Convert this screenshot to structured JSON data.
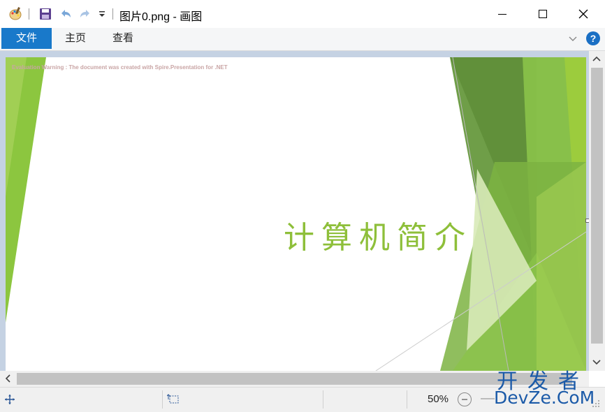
{
  "window": {
    "title": "图片0.png - 画图"
  },
  "quick_access": {
    "icons": [
      "paint-app-icon",
      "save-icon",
      "undo-icon",
      "redo-icon",
      "customize-dropdown-icon"
    ]
  },
  "window_controls": [
    "minimize-icon",
    "maximize-icon",
    "close-icon"
  ],
  "ribbon": {
    "tabs": [
      {
        "label": "文件",
        "active": true
      },
      {
        "label": "主页",
        "active": false
      },
      {
        "label": "查看",
        "active": false
      }
    ]
  },
  "slide": {
    "watermark": "Evaluation Warning : The document was created with  Spire.Presentation for .NET",
    "title": "计算机简介",
    "colors": {
      "title": "#8ebf3a",
      "green_dark": "#6a9a3c",
      "green_mid": "#7cb342",
      "green_light": "#9acb3c",
      "green_pale": "#d8eab8"
    }
  },
  "statusbar": {
    "zoom": "50%"
  },
  "brand_watermark": {
    "top": "开发者",
    "bottom": "DevZe.CoM"
  }
}
